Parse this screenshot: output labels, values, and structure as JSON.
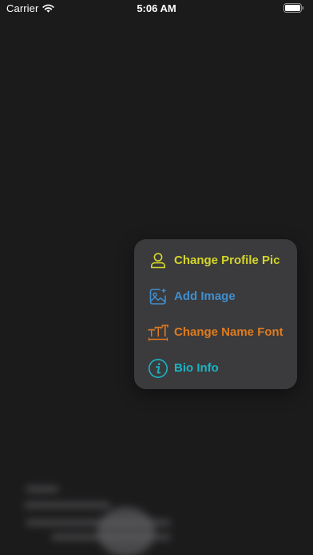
{
  "status_bar": {
    "carrier": "Carrier",
    "time": "5:06 AM",
    "icons": [
      "wifi-icon",
      "battery-icon"
    ]
  },
  "menu": {
    "items": [
      {
        "label": "Change Profile Pic",
        "icon": "person-icon",
        "color": "#d4d62a"
      },
      {
        "label": "Add Image",
        "icon": "photo-sparkle-icon",
        "color": "#3f8fcf"
      },
      {
        "label": "Change Name Font",
        "icon": "text-font-icon",
        "color": "#e07b1e"
      },
      {
        "label": "Bio Info",
        "icon": "info-circle-icon",
        "color": "#1bb3c2"
      }
    ]
  },
  "colors": {
    "background": "#1b1b1c",
    "menu_background": "#3b3b3d"
  }
}
